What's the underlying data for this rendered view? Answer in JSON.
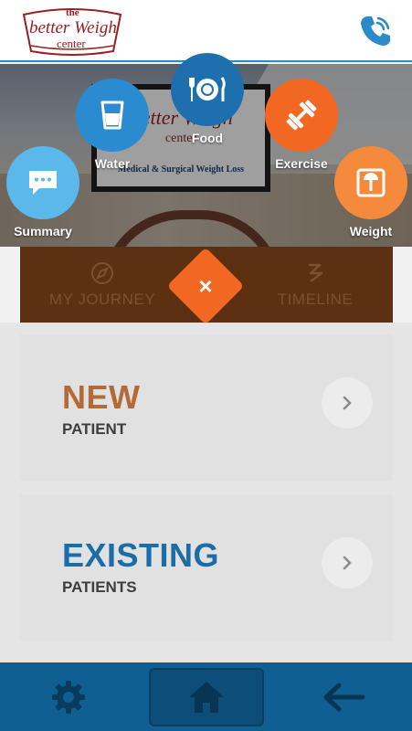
{
  "header": {
    "logo": {
      "line1": "the",
      "line2": "better Weigh",
      "line3": "center"
    }
  },
  "hero": {
    "sign": {
      "line1": "the",
      "line2": "Better Weigh",
      "line3": "center",
      "line4": "Medical & Surgical Weight Loss"
    }
  },
  "radial_menu": {
    "summary": "Summary",
    "water": "Water",
    "food": "Food",
    "exercise": "Exercise",
    "weight": "Weight"
  },
  "tabs": {
    "journey": "MY JOURNEY",
    "timeline": "TIMELINE",
    "close": "×"
  },
  "panels": {
    "new": {
      "title": "NEW",
      "subtitle": "PATIENT"
    },
    "existing": {
      "title": "EXISTING",
      "subtitle": "PATIENTS"
    }
  },
  "colors": {
    "brand_blue": "#2a8bc8",
    "orange": "#f26722",
    "new_title": "#b36a39",
    "existing_title": "#1c6da7",
    "summary_circle": "#5ab9ea",
    "water_circle": "#2a8bd0",
    "food_circle": "#1d6fae",
    "exercise_circle": "#f26722",
    "weight_circle": "#f58a3c"
  },
  "icons": {
    "phone": "phone-icon",
    "settings": "gear-icon",
    "home": "home-icon",
    "back": "arrow-left-icon"
  }
}
